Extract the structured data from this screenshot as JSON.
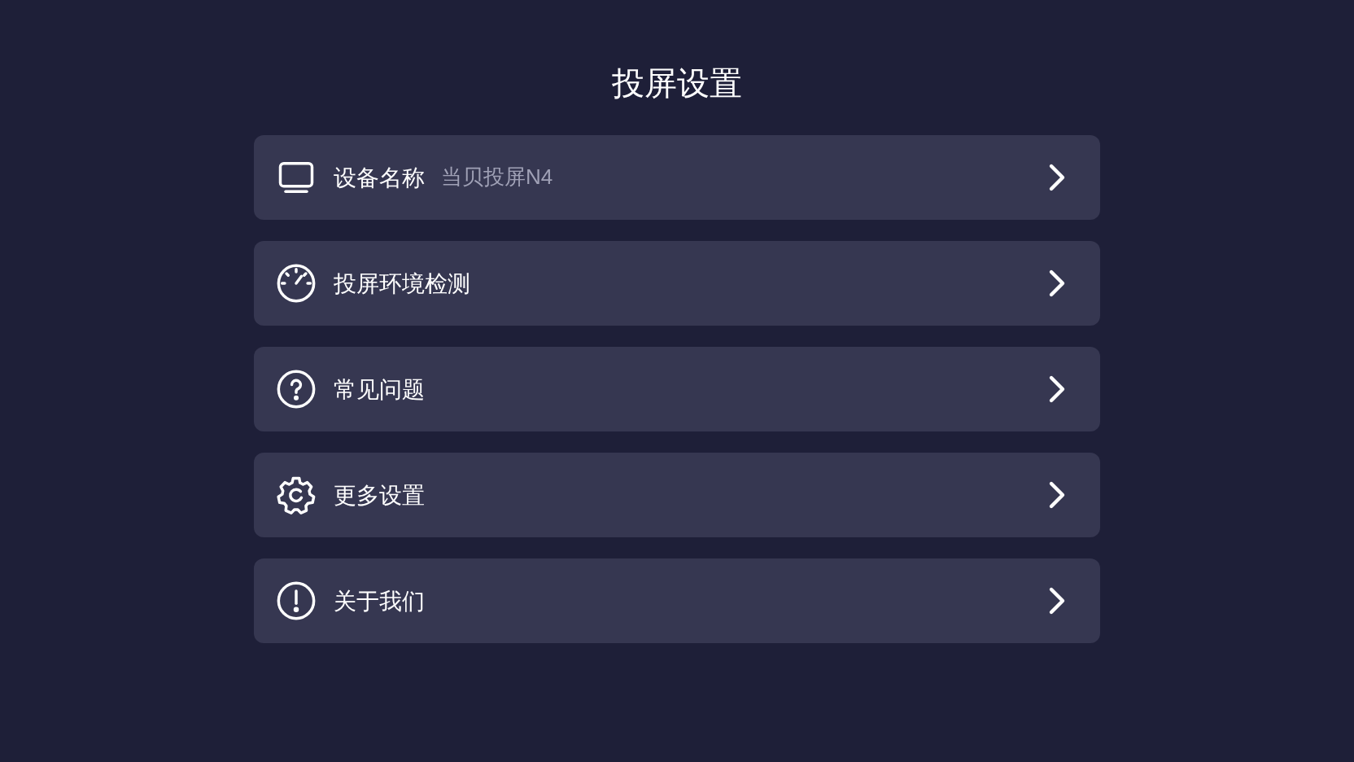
{
  "title": "投屏设置",
  "items": [
    {
      "kind": "tv",
      "label": "设备名称",
      "value": "当贝投屏N4"
    },
    {
      "kind": "gauge",
      "label": "投屏环境检测"
    },
    {
      "kind": "help",
      "label": "常见问题"
    },
    {
      "kind": "gear",
      "label": "更多设置"
    },
    {
      "kind": "info",
      "label": "关于我们"
    }
  ]
}
